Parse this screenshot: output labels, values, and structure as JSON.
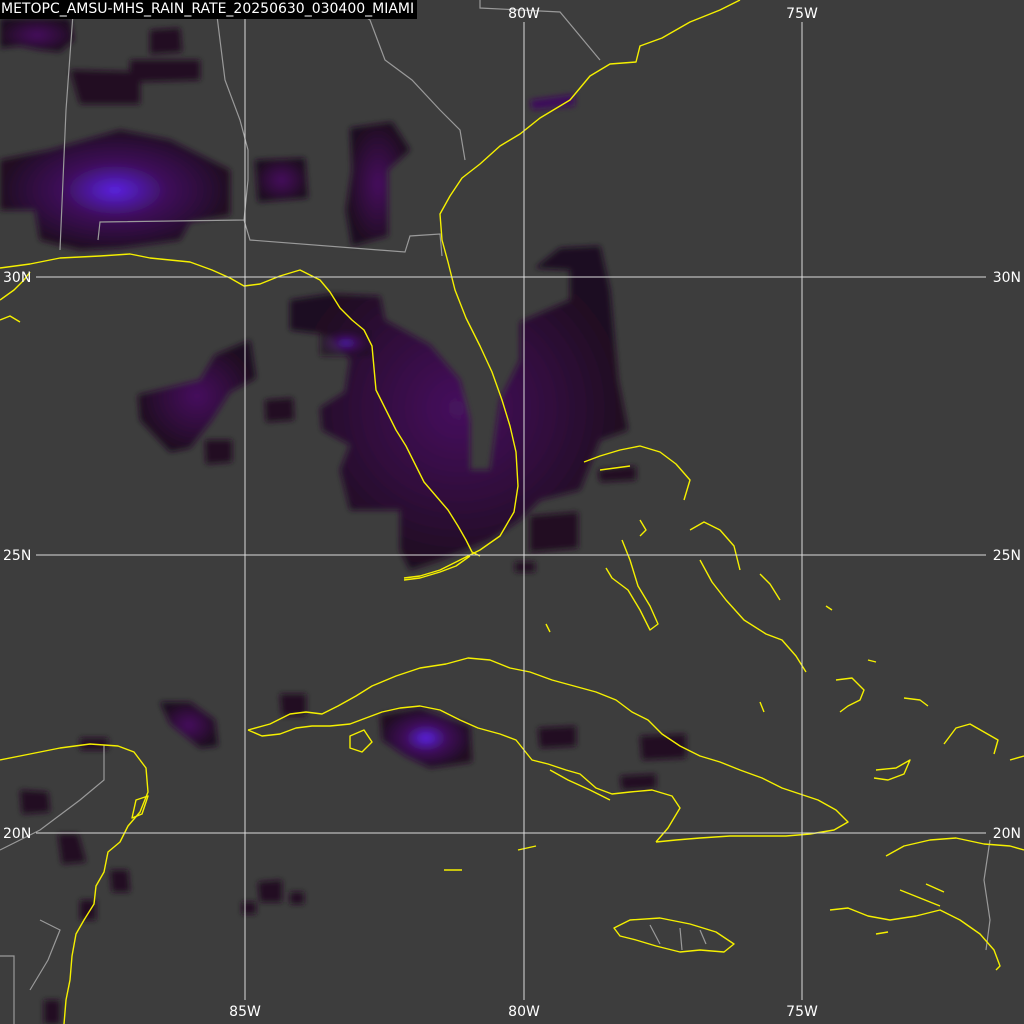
{
  "title": "METOPC_AMSU-MHS_RAIN_RATE_20250630_030400_MIAMI",
  "colors": {
    "background": "#3d3d3d",
    "coastline": "#f5f000",
    "borders": "#9a9a9a",
    "gridlines": "#dcdcdc",
    "rain_low": "#1e0a1e",
    "rain_mid": "#3e0f5a",
    "rain_high": "#5a1fd0"
  },
  "gridlines": {
    "longitude_labels": [
      "85W",
      "80W",
      "75W"
    ],
    "latitude_labels_left": [
      "30N",
      "25N",
      "20N"
    ],
    "latitude_labels_right": [
      "30N",
      "25N",
      "20N"
    ],
    "top_longitude_labels": [
      "80W",
      "75W"
    ]
  },
  "legend": {
    "precipitation_layer": "rain rate overlay",
    "land_outline": "coastline",
    "political_boundaries": "state/country borders"
  }
}
